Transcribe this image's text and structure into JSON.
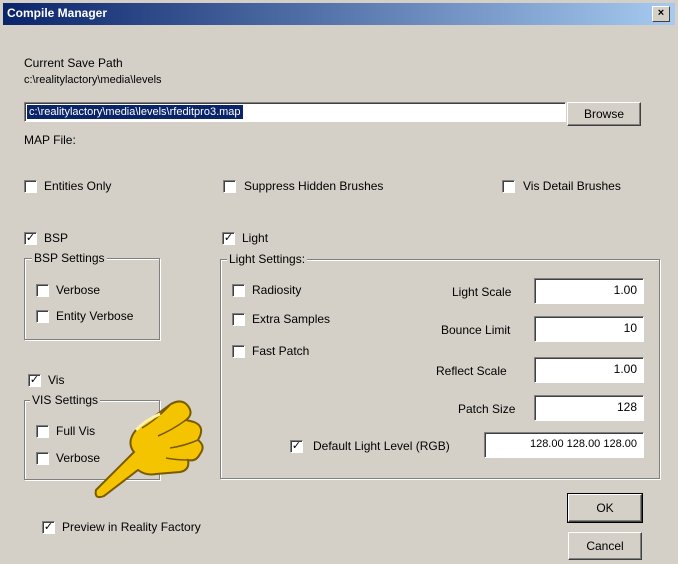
{
  "window": {
    "title": "Compile Manager",
    "close_glyph": "×"
  },
  "save_path": {
    "label": "Current Save Path",
    "value": "c:\\realitylactory\\media\\levels"
  },
  "map_file": {
    "value": "c:\\realitylactory\\media\\levels\\rfeditpro3.map",
    "browse_label": "Browse",
    "label": "MAP File:"
  },
  "options": {
    "entities_only": {
      "label": "Entities Only",
      "checked": false
    },
    "suppress_hidden": {
      "label": "Suppress Hidden Brushes",
      "checked": false
    },
    "vis_detail": {
      "label": "Vis Detail Brushes",
      "checked": false
    }
  },
  "bsp": {
    "label": "BSP",
    "checked": true,
    "settings_title": "BSP Settings",
    "verbose": {
      "label": "Verbose",
      "checked": false
    },
    "entity_verbose": {
      "label": "Entity Verbose",
      "checked": false
    }
  },
  "vis": {
    "label": "Vis",
    "checked": true,
    "settings_title": "VIS Settings",
    "full_vis": {
      "label": "Full Vis",
      "checked": false
    },
    "verbose": {
      "label": "Verbose",
      "checked": false
    }
  },
  "light": {
    "label": "Light",
    "checked": true,
    "settings_title": "Light Settings:",
    "radiosity": {
      "label": "Radiosity",
      "checked": false
    },
    "extra_samples": {
      "label": "Extra Samples",
      "checked": false
    },
    "fast_patch": {
      "label": "Fast Patch",
      "checked": false
    },
    "light_scale": {
      "label": "Light Scale",
      "value": "1.00"
    },
    "bounce_limit": {
      "label": "Bounce Limit",
      "value": "10"
    },
    "reflect_scale": {
      "label": "Reflect Scale",
      "value": "1.00"
    },
    "patch_size": {
      "label": "Patch Size",
      "value": "128"
    },
    "default_light": {
      "label": "Default Light Level (RGB)",
      "checked": true,
      "value": "128.00 128.00 128.00"
    }
  },
  "preview": {
    "label": "Preview in Reality Factory",
    "checked": true
  },
  "buttons": {
    "ok": "OK",
    "cancel": "Cancel"
  },
  "check_glyph": "✓"
}
